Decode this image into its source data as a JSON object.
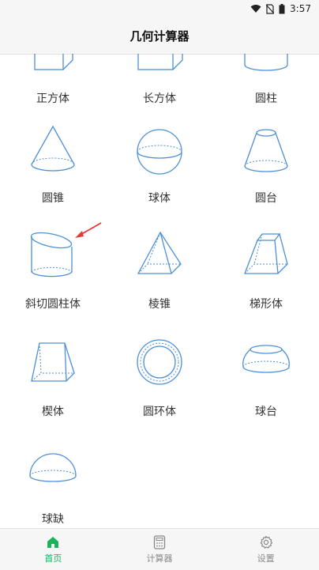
{
  "status": {
    "time": "3:57"
  },
  "appbar": {
    "title": "几何计算器"
  },
  "shapes": {
    "cube": "正方体",
    "cuboid": "长方体",
    "cylinder": "圆柱",
    "cone": "圆锥",
    "sphere": "球体",
    "frustum": "圆台",
    "oblique_cylinder": "斜切圆柱体",
    "pyramid": "棱锥",
    "prismatoid": "梯形体",
    "wedge": "楔体",
    "torus": "圆环体",
    "spherical_frustum": "球台",
    "spherical_cap": "球缺"
  },
  "tabs": {
    "home": "首页",
    "calculator": "计算器",
    "settings": "设置"
  },
  "colors": {
    "accent": "#1bb35a",
    "shape_stroke": "#4d8fd6",
    "arrow": "#e53935"
  }
}
